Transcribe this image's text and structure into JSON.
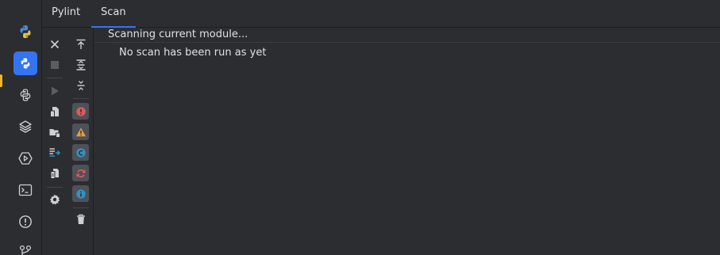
{
  "tabs": [
    {
      "label": "Pylint",
      "active": false
    },
    {
      "label": "Scan",
      "active": true
    }
  ],
  "status": "Scanning current module...",
  "message": "No scan has been run as yet",
  "activity_icons": [
    "python-icon",
    "pylint-icon",
    "python-packages-icon",
    "layers-icon",
    "services-icon",
    "terminal-icon",
    "problems-icon",
    "git-icon"
  ],
  "toolbar_left": [
    "close-icon",
    "stop-icon",
    "run-icon",
    "check-file-icon",
    "check-folder-icon",
    "check-changes-icon",
    "check-module-icon",
    "settings-icon"
  ],
  "toolbar_right": [
    "scroll-to-top-icon",
    "expand-all-icon",
    "collapse-all-icon",
    "error-filter-icon",
    "warning-filter-icon",
    "convention-filter-icon",
    "refactor-filter-icon",
    "info-filter-icon",
    "delete-icon"
  ],
  "colors": {
    "accent": "#3574f0",
    "error": "#db5c5c",
    "warning": "#e0a040",
    "convention": "#3592c4",
    "refactor": "#db5c5c",
    "info": "#3592c4"
  }
}
